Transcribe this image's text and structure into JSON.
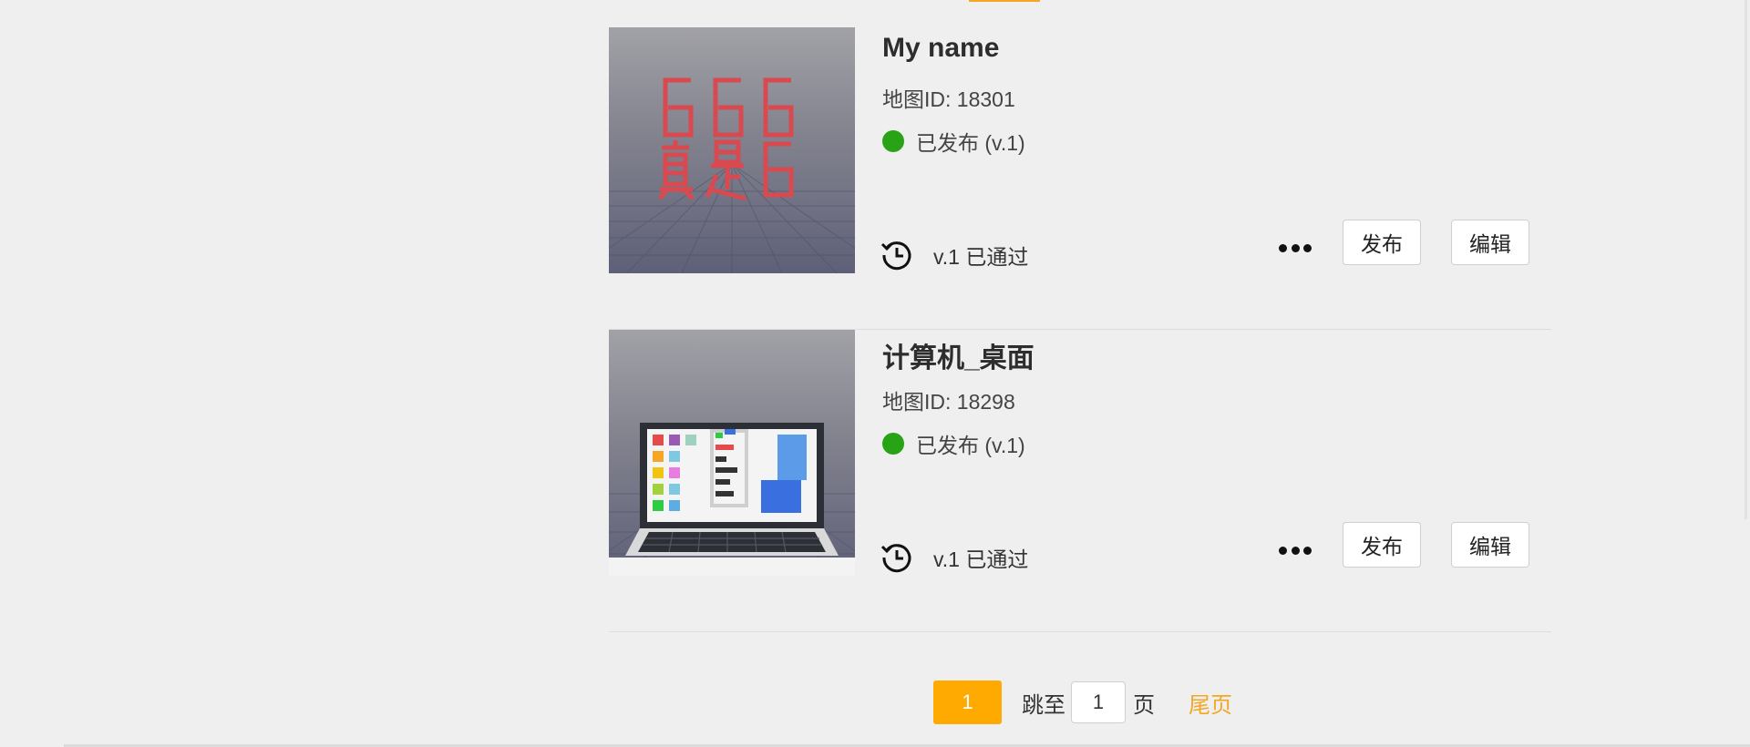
{
  "maps": [
    {
      "title": "My name",
      "map_id": "地图ID: 18301",
      "status": "已发布 (v.1)",
      "history": "v.1 已通过",
      "thumbnail": "666-zhenshi6-pixel-art",
      "thumbnail_text": "666 真是6",
      "publish_label": "发布",
      "edit_label": "编辑"
    },
    {
      "title": "计算机_桌面",
      "map_id": "地图ID: 18298",
      "status": "已发布 (v.1)",
      "history": "v.1 已通过",
      "thumbnail": "voxel-laptop-desktop",
      "publish_label": "发布",
      "edit_label": "编辑"
    }
  ],
  "pagination": {
    "current_page": "1",
    "jump_label": "跳至",
    "jump_value": "1",
    "page_suffix": "页",
    "last_page": "尾页"
  },
  "colors": {
    "accent": "#ffaa00",
    "link": "#f5a623",
    "status_published": "#27a315",
    "background": "#efefef"
  },
  "icons": {
    "status": "status-dot-icon",
    "history": "history-clock-icon",
    "more": "more-dots-icon"
  }
}
